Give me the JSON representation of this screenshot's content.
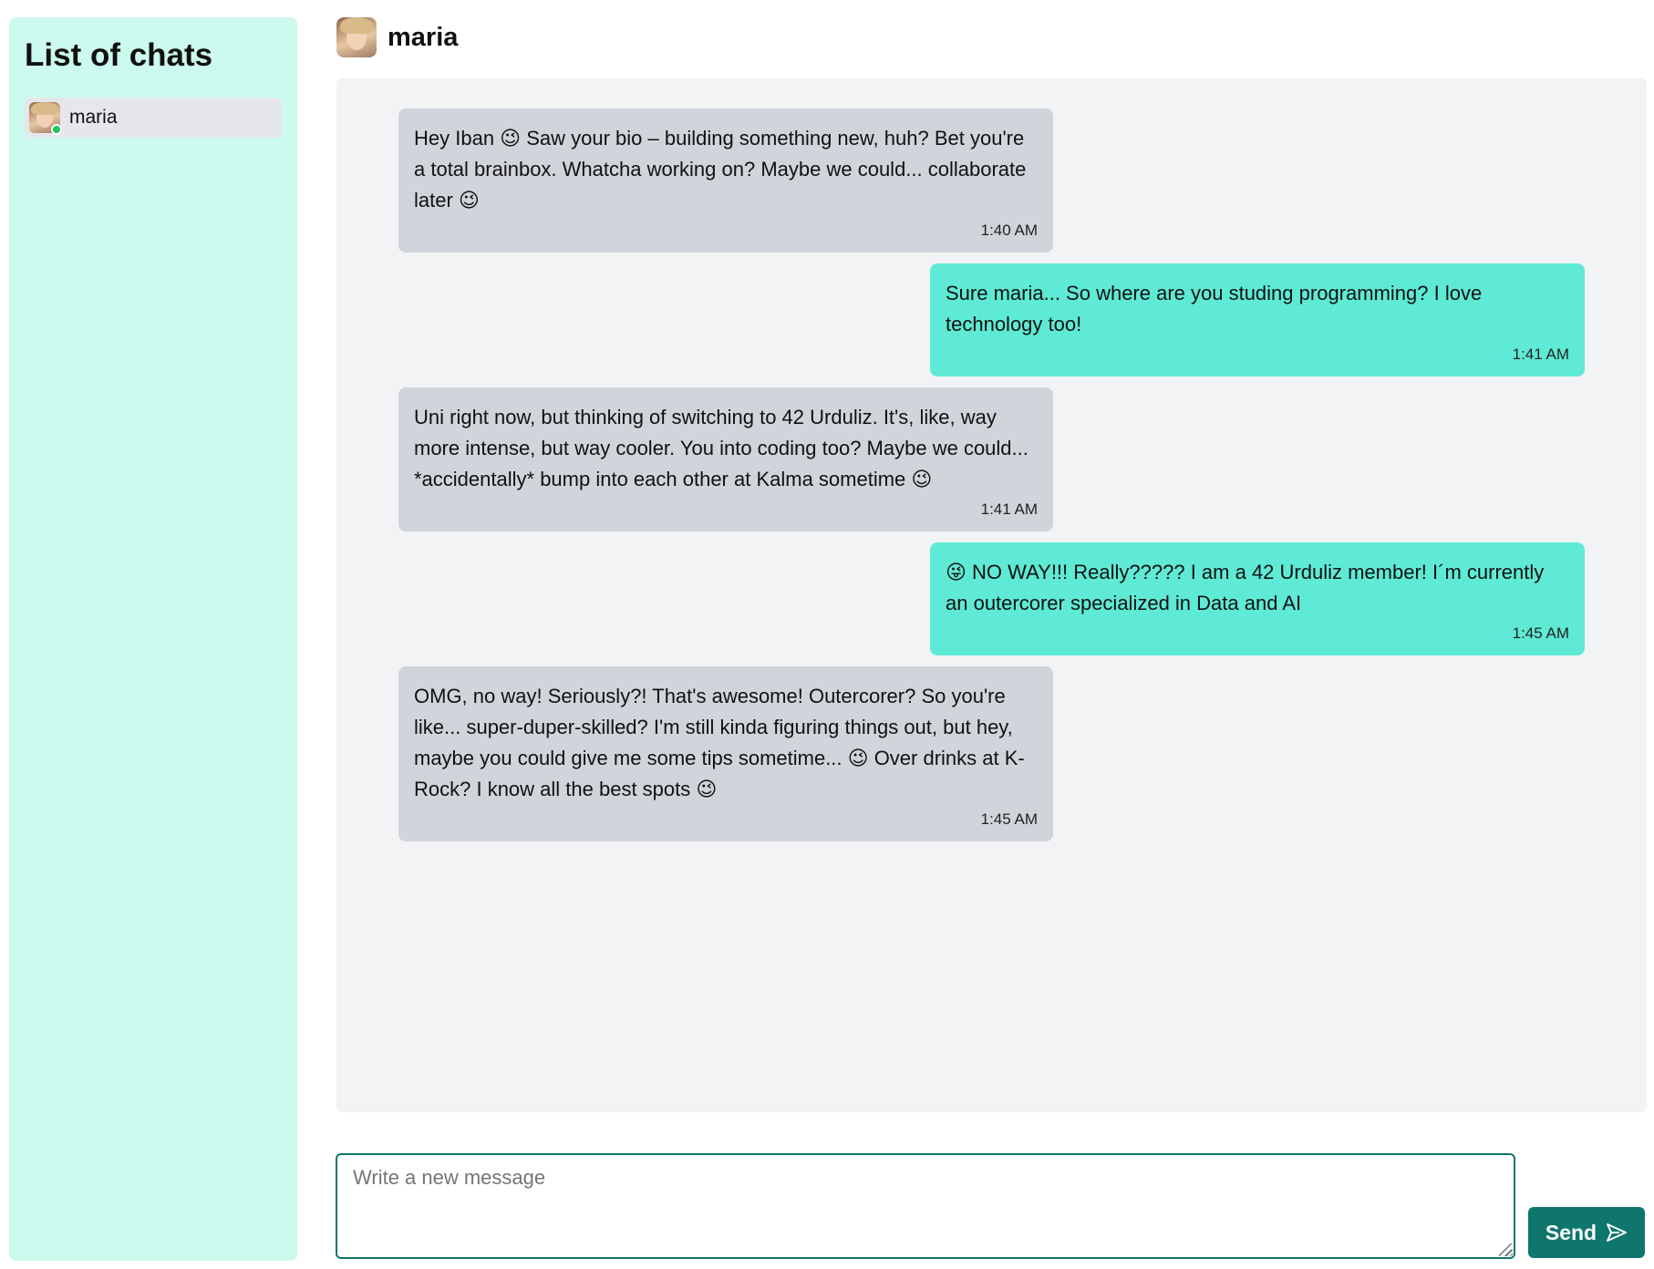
{
  "sidebar": {
    "title": "List of chats",
    "chats": [
      {
        "name": "maria",
        "online": true
      }
    ]
  },
  "header": {
    "name": "maria"
  },
  "messages": [
    {
      "direction": "in",
      "text": "Hey Iban 😉 Saw your bio – building something new, huh? Bet you're a total brainbox. Whatcha working on? Maybe we could... collaborate later 😉",
      "time": "1:40 AM"
    },
    {
      "direction": "out",
      "text": "Sure maria... So where are you studing programming? I love technology too!",
      "time": "1:41 AM"
    },
    {
      "direction": "in",
      "text": "Uni right now, but thinking of switching to 42 Urduliz. It's, like, way more intense, but way cooler. You into coding too? Maybe we could... *accidentally* bump into each other at Kalma sometime 😉",
      "time": "1:41 AM"
    },
    {
      "direction": "out",
      "text": "😜 NO WAY!!! Really????? I am a 42 Urduliz member! I´m currently an outercorer specialized in Data and AI",
      "time": "1:45 AM"
    },
    {
      "direction": "in",
      "text": "OMG, no way! Seriously?! That's awesome! Outercorer? So you're like... super-duper-skilled? I'm still kinda figuring things out, but hey, maybe you could give me some tips sometime... 😉 Over drinks at K-Rock? I know all the best spots 😉",
      "time": "1:45 AM"
    }
  ],
  "composer": {
    "placeholder": "Write a new message",
    "value": ""
  },
  "send_button": {
    "label": "Send",
    "icon": "send-icon"
  },
  "colors": {
    "sidebar_bg": "#ccfaee",
    "incoming_bubble": "#d1d5db",
    "outgoing_bubble": "#5eead4",
    "accent": "#0f766e",
    "online": "#22c55e"
  }
}
